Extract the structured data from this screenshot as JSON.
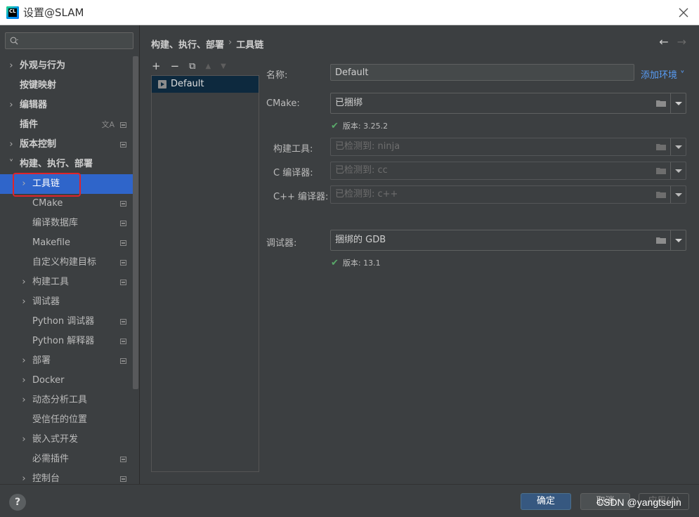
{
  "window": {
    "title": "设置@SLAM"
  },
  "sidebar": {
    "search_placeholder": "",
    "items": [
      {
        "label": "外观与行为",
        "arrow": "›",
        "bold": true,
        "indent": 0,
        "project": false
      },
      {
        "label": "按键映射",
        "arrow": "",
        "bold": true,
        "indent": 0,
        "project": false
      },
      {
        "label": "编辑器",
        "arrow": "›",
        "bold": true,
        "indent": 0,
        "project": false
      },
      {
        "label": "插件",
        "arrow": "",
        "bold": true,
        "indent": 0,
        "project": true,
        "lang": "文A"
      },
      {
        "label": "版本控制",
        "arrow": "›",
        "bold": true,
        "indent": 0,
        "project": true
      },
      {
        "label": "构建、执行、部署",
        "arrow": "˅",
        "bold": true,
        "indent": 0,
        "project": false
      },
      {
        "label": "工具链",
        "arrow": "›",
        "bold": false,
        "indent": 1,
        "project": false,
        "selected": true
      },
      {
        "label": "CMake",
        "arrow": "",
        "bold": false,
        "indent": 1,
        "project": true
      },
      {
        "label": "编译数据库",
        "arrow": "",
        "bold": false,
        "indent": 1,
        "project": true
      },
      {
        "label": "Makefile",
        "arrow": "",
        "bold": false,
        "indent": 1,
        "project": true
      },
      {
        "label": "自定义构建目标",
        "arrow": "",
        "bold": false,
        "indent": 1,
        "project": true
      },
      {
        "label": "构建工具",
        "arrow": "›",
        "bold": false,
        "indent": 1,
        "project": true
      },
      {
        "label": "调试器",
        "arrow": "›",
        "bold": false,
        "indent": 1,
        "project": false
      },
      {
        "label": "Python 调试器",
        "arrow": "",
        "bold": false,
        "indent": 1,
        "project": true
      },
      {
        "label": "Python 解释器",
        "arrow": "",
        "bold": false,
        "indent": 1,
        "project": true
      },
      {
        "label": "部署",
        "arrow": "›",
        "bold": false,
        "indent": 1,
        "project": true
      },
      {
        "label": "Docker",
        "arrow": "›",
        "bold": false,
        "indent": 1,
        "project": false
      },
      {
        "label": "动态分析工具",
        "arrow": "›",
        "bold": false,
        "indent": 1,
        "project": false
      },
      {
        "label": "受信任的位置",
        "arrow": "",
        "bold": false,
        "indent": 1,
        "project": false
      },
      {
        "label": "嵌入式开发",
        "arrow": "›",
        "bold": false,
        "indent": 1,
        "project": false
      },
      {
        "label": "必需插件",
        "arrow": "",
        "bold": false,
        "indent": 1,
        "project": true
      },
      {
        "label": "控制台",
        "arrow": "›",
        "bold": false,
        "indent": 1,
        "project": true
      }
    ]
  },
  "breadcrumb": {
    "parent": "构建、执行、部署",
    "separator": "›",
    "current": "工具链"
  },
  "nav": {
    "back": "←",
    "forward": "→"
  },
  "toolbar": {
    "add": "+",
    "remove": "−",
    "copy": "⧉",
    "up": "▲",
    "down": "▼"
  },
  "toolchains": [
    {
      "name": "Default"
    }
  ],
  "form": {
    "name_label": "名称:",
    "name_value": "Default",
    "add_env": "添加环境 ˅",
    "cmake_label": "CMake:",
    "cmake_value": "已捆绑",
    "cmake_version": "版本: 3.25.2",
    "build_tool_label": "构建工具:",
    "build_tool_value": "已检测到: ninja",
    "c_compiler_label": "C 编译器:",
    "c_compiler_value": "已检测到: cc",
    "cpp_compiler_label": "C++ 编译器:",
    "cpp_compiler_value": "已检测到: c++",
    "debugger_label": "调试器:",
    "debugger_value": "捆绑的 GDB",
    "debugger_version": "版本: 13.1",
    "check_mark": "✔"
  },
  "footer": {
    "help": "?",
    "ok": "确定",
    "cancel": "取消",
    "apply": "应用(A)",
    "watermark": "CSDN @yangtsejin"
  },
  "colors": {
    "accent": "#2f65ca",
    "link": "#589df6",
    "check": "#59a869",
    "highlight": "#e0242a"
  }
}
